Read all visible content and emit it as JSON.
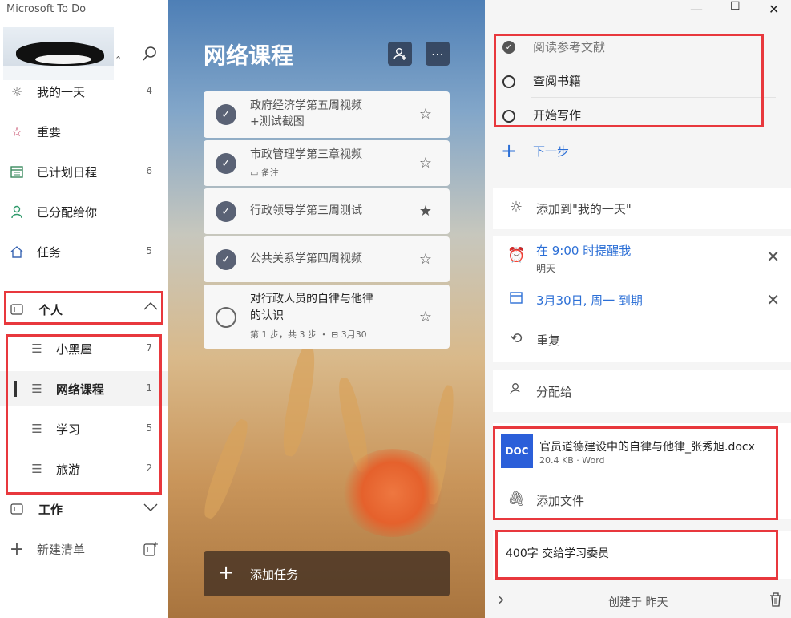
{
  "app": {
    "title": "Microsoft To Do"
  },
  "sidebar": {
    "items": [
      {
        "icon": "sun-icon",
        "label": "我的一天",
        "count": "4"
      },
      {
        "icon": "star-icon",
        "label": "重要",
        "count": ""
      },
      {
        "icon": "calendar-icon",
        "label": "已计划日程",
        "count": "6"
      },
      {
        "icon": "person-icon",
        "label": "已分配给你",
        "count": ""
      },
      {
        "icon": "home-icon",
        "label": "任务",
        "count": "5"
      }
    ],
    "groups": [
      {
        "label": "个人",
        "lists": [
          {
            "label": "小黑屋",
            "count": "7"
          },
          {
            "label": "网络课程",
            "count": "1"
          },
          {
            "label": "学习",
            "count": "5"
          },
          {
            "label": "旅游",
            "count": "2"
          }
        ]
      },
      {
        "label": "工作"
      }
    ],
    "new_list_label": "新建清单"
  },
  "list": {
    "title": "网络课程",
    "tasks": [
      {
        "title_line1": "政府经济学第五周视频",
        "title_line2": "+测试截图",
        "sub": "",
        "completed": true,
        "starred": false
      },
      {
        "title_line1": "市政管理学第三章视频",
        "title_line2": "",
        "sub": "备注",
        "completed": true,
        "starred": false
      },
      {
        "title_line1": "行政领导学第三周测试",
        "title_line2": "",
        "sub": "",
        "completed": true,
        "starred": true
      },
      {
        "title_line1": "公共关系学第四周视频",
        "title_line2": "",
        "sub": "",
        "completed": true,
        "starred": false
      },
      {
        "title_line1": "对行政人员的自律与他律",
        "title_line2": "的认识",
        "sub": "第 1 步，共 3 步 ・ ⊟ 3月30",
        "completed": false,
        "starred": false
      }
    ],
    "add_task_label": "添加任务"
  },
  "detail": {
    "steps": [
      {
        "label": "阅读参考文献",
        "done": true
      },
      {
        "label": "查阅书籍",
        "done": false
      },
      {
        "label": "开始写作",
        "done": false
      }
    ],
    "next_step_label": "下一步",
    "add_my_day_label": "添加到\"我的一天\"",
    "reminder_label": "在 9:00 时提醒我",
    "reminder_sub": "明天",
    "due_label": "3月30日, 周一 到期",
    "repeat_label": "重复",
    "assign_label": "分配给",
    "file": {
      "badge": "DOC",
      "name": "官员道德建设中的自律与他律_张秀旭.docx",
      "meta": "20.4 KB · Word"
    },
    "add_file_label": "添加文件",
    "note": "400字  交给学习委员",
    "footer_created": "创建于 昨天"
  },
  "colors": {
    "accent_blue": "#2c6fd6",
    "annotation_red": "#e8383d",
    "doc_badge": "#2b5fd9"
  }
}
